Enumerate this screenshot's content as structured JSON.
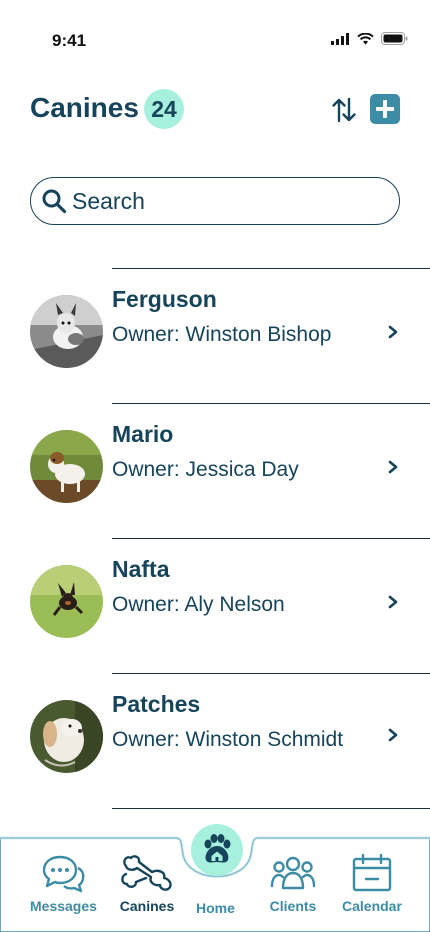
{
  "status_bar": {
    "time": "9:41"
  },
  "header": {
    "title": "Canines",
    "count": "24"
  },
  "search": {
    "placeholder": "Search"
  },
  "dogs": [
    {
      "name": "Ferguson",
      "owner": "Owner: Winston Bishop"
    },
    {
      "name": "Mario",
      "owner": "Owner: Jessica Day"
    },
    {
      "name": "Nafta",
      "owner": "Owner: Aly Nelson"
    },
    {
      "name": "Patches",
      "owner": "Owner: Winston Schmidt"
    }
  ],
  "nav": {
    "messages": "Messages",
    "canines": "Canines",
    "home": "Home",
    "clients": "Clients",
    "calendar": "Calendar"
  },
  "colors": {
    "primary": "#16445a",
    "accent": "#3d8ca5",
    "badge": "#a7f0dd"
  }
}
